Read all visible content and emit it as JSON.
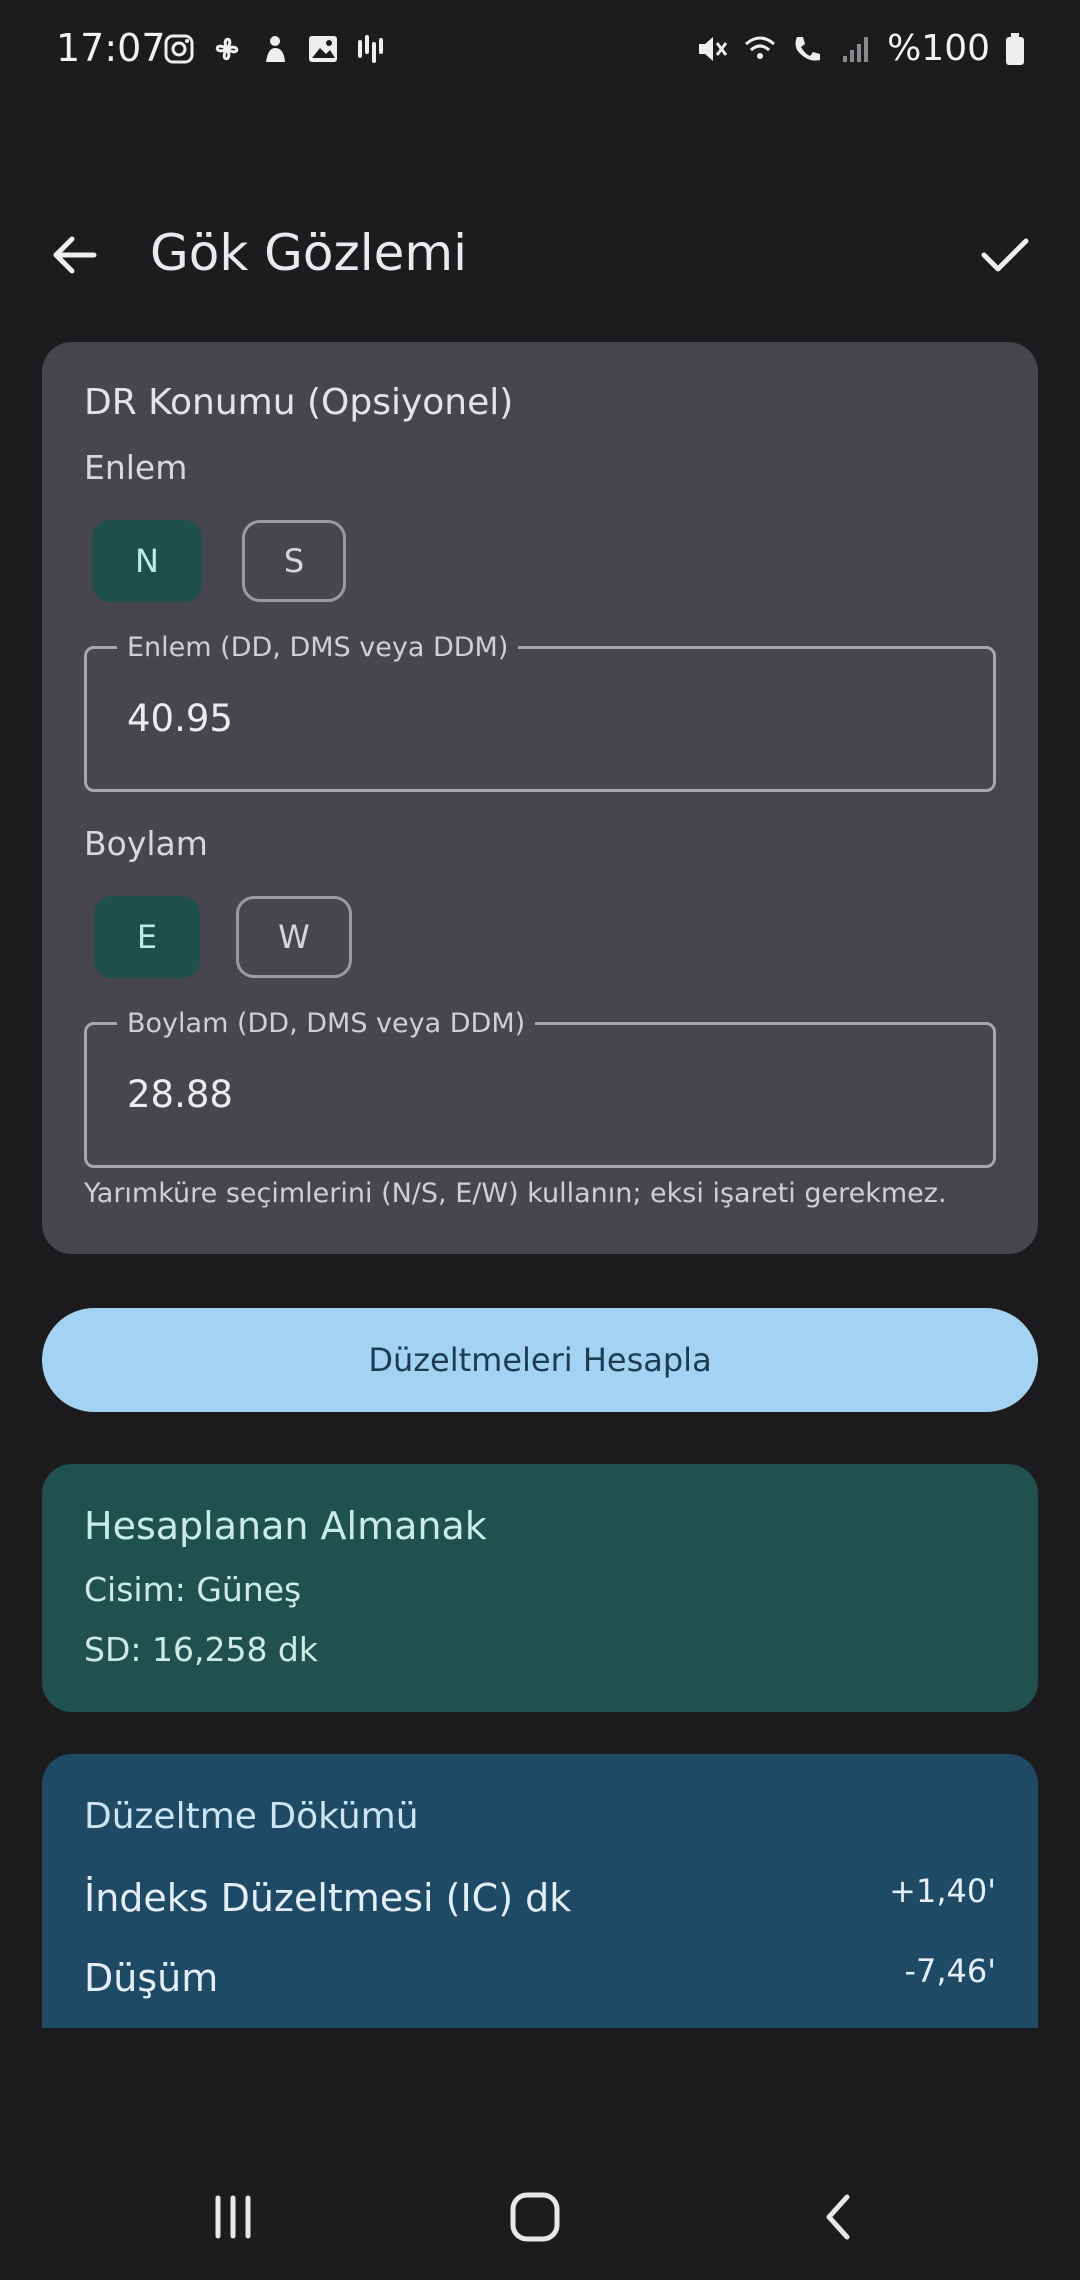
{
  "status_bar": {
    "time": "17:07",
    "battery_text": "%100",
    "left_icons": [
      "instagram-icon",
      "pinwheel-icon",
      "hand-icon",
      "gallery-icon",
      "soundwave-icon"
    ],
    "right_icons": [
      "mute-icon",
      "wifi-calling-icon",
      "phone-wifi-icon",
      "signal-icon",
      "battery-icon"
    ]
  },
  "app_bar": {
    "title": "Gök Gözlemi",
    "back_icon": "arrow-back-icon",
    "confirm_icon": "check-icon"
  },
  "dr_card": {
    "title": "DR Konumu (Opsiyonel)",
    "latitude": {
      "label": "Enlem",
      "options": [
        "N",
        "S"
      ],
      "selected": "N",
      "field_label": "Enlem (DD, DMS veya DDM)",
      "value": "40.95"
    },
    "longitude": {
      "label": "Boylam",
      "options": [
        "E",
        "W"
      ],
      "selected": "E",
      "field_label": "Boylam (DD, DMS veya DDM)",
      "value": "28.88"
    },
    "helper": "Yarımküre seçimlerini (N/S, E/W) kullanın; eksi işareti gerekmez."
  },
  "compute_button": "Düzeltmeleri Hesapla",
  "almanac_card": {
    "title": "Hesaplanan Almanak",
    "body": "Cisim: Güneş",
    "sd": "SD: 16,258 dk"
  },
  "breakdown_card": {
    "title": "Düzeltme Dökümü",
    "rows": [
      {
        "label": "İndeks Düzeltmesi (IC) dk",
        "value": "+1,40'"
      },
      {
        "label": "Düşüm",
        "value": "-7,46'"
      }
    ]
  },
  "colors": {
    "background": "#1c1c1f",
    "card": "#46464c",
    "chip_selected": "#1f4f4b",
    "primary_button": "#a3d2f2",
    "almanac_card": "#21514e",
    "breakdown_card": "#1e4a66"
  },
  "nav_bar": {
    "icons": [
      "recents-icon",
      "home-icon",
      "back-nav-icon"
    ]
  }
}
